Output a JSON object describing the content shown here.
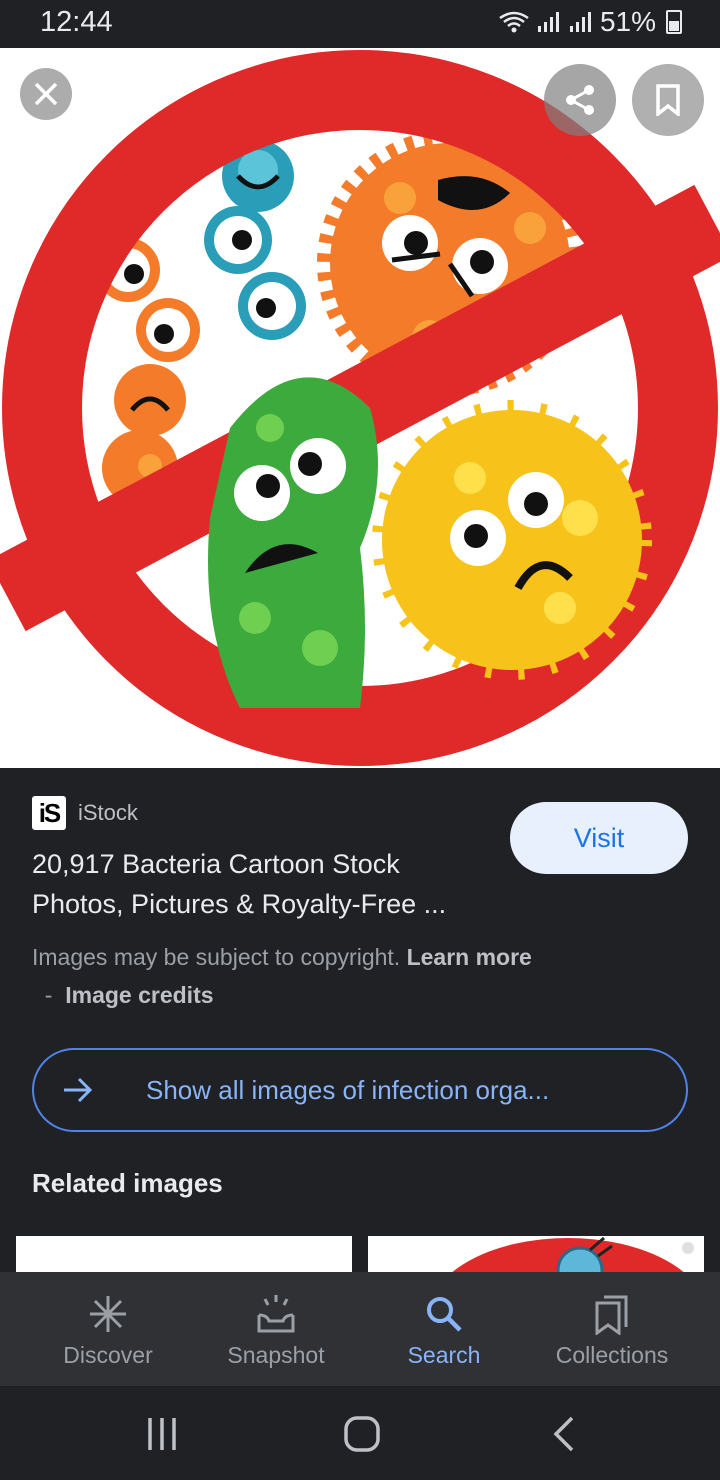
{
  "status_bar": {
    "time": "12:44",
    "battery": "51%"
  },
  "viewer": {
    "close_icon": "close-icon",
    "share_icon": "share-icon",
    "save_icon": "bookmark-icon"
  },
  "result": {
    "source_logo": "iS",
    "source_name": "iStock",
    "title": "20,917 Bacteria Cartoon Stock Photos, Pictures & Royalty-Free ...",
    "visit_label": "Visit",
    "copyright_text": "Images may be subject to copyright.",
    "learn_more": "Learn more",
    "dash": "-",
    "image_credits": "Image credits",
    "show_all_label": "Show all images of infection orga..."
  },
  "related": {
    "title": "Related images"
  },
  "bottom_nav": {
    "items": [
      {
        "label": "Discover",
        "icon": "asterisk-icon",
        "active": false
      },
      {
        "label": "Snapshot",
        "icon": "snapshot-icon",
        "active": false
      },
      {
        "label": "Search",
        "icon": "search-icon",
        "active": true
      },
      {
        "label": "Collections",
        "icon": "collections-icon",
        "active": false
      }
    ]
  },
  "colors": {
    "accent": "#8ab4f8",
    "visit_bg": "#e8f0fe",
    "visit_text": "#1a73e8",
    "background": "#202124",
    "prohibit_red": "#e02a2a"
  }
}
